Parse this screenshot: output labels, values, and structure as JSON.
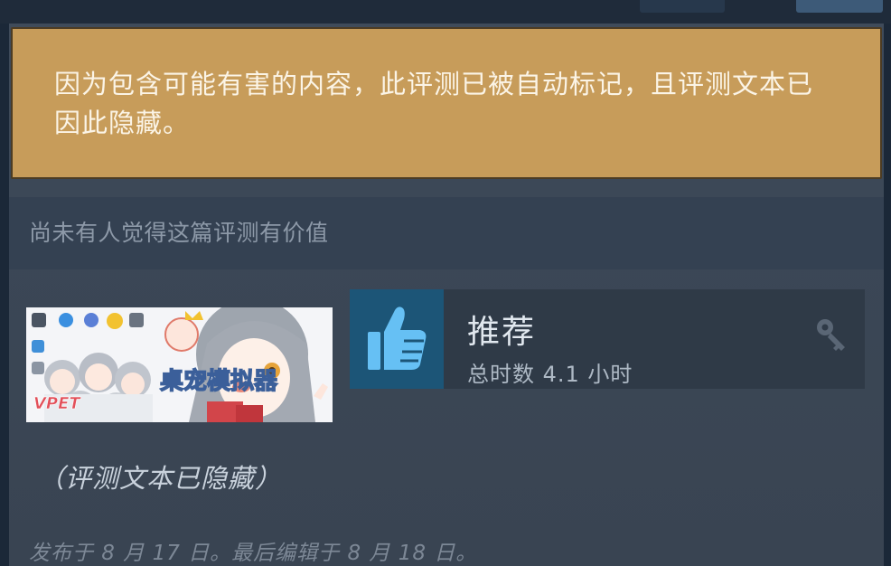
{
  "warning": {
    "text": "因为包含可能有害的内容，此评测已被自动标记，且评测文本已因此隐藏。"
  },
  "helpful": {
    "text": "尚未有人觉得这篇评测有价值"
  },
  "game": {
    "capsule_text": "VPET",
    "capsule_title": "桌宠模拟器"
  },
  "recommendation": {
    "title": "推荐",
    "hours": "总时数 4.1 小时",
    "icon": "thumbs-up-icon",
    "key_icon": "key-icon"
  },
  "review": {
    "hidden_note": "（评测文本已隐藏）",
    "posted": "发布于 8 月 17 日。最后编辑于 8 月 18 日。"
  },
  "colors": {
    "warning_bg": "#c79c5a",
    "thumb_bg": "#1c5577",
    "thumb_icon": "#66c0f4",
    "page_bg": "#1b2838"
  }
}
